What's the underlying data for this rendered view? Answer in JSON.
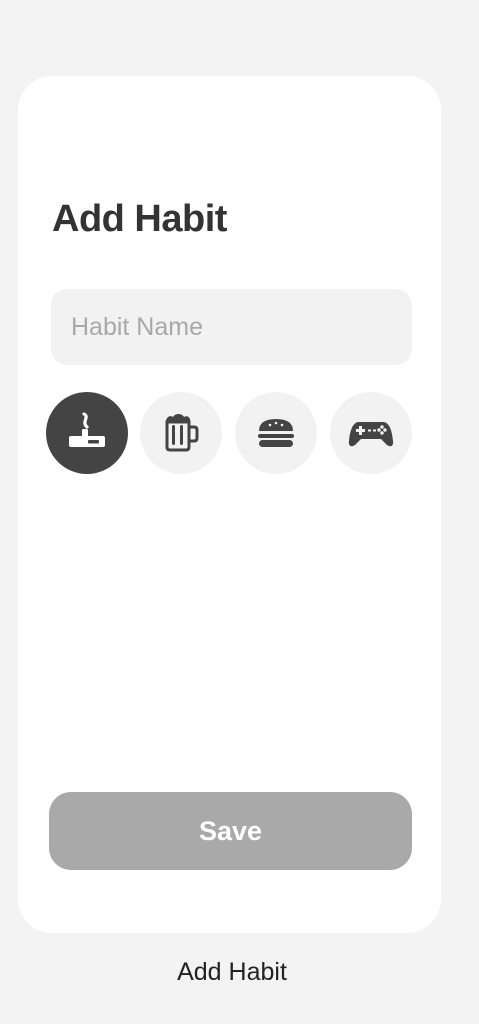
{
  "screen": {
    "title": "Add Habit",
    "caption": "Add Habit"
  },
  "habit_name": {
    "placeholder": "Habit Name",
    "value": ""
  },
  "icons": [
    {
      "name": "cigarette-icon",
      "selected": true
    },
    {
      "name": "beer-mug-icon",
      "selected": false
    },
    {
      "name": "burger-icon",
      "selected": false
    },
    {
      "name": "gamepad-icon",
      "selected": false
    }
  ],
  "save_button": {
    "label": "Save",
    "enabled": false
  },
  "colors": {
    "background": "#f3f3f3",
    "card": "#ffffff",
    "selected_icon_bg": "#444444",
    "icon_bg": "#f2f2f2",
    "save_disabled": "#a9a9a9"
  }
}
